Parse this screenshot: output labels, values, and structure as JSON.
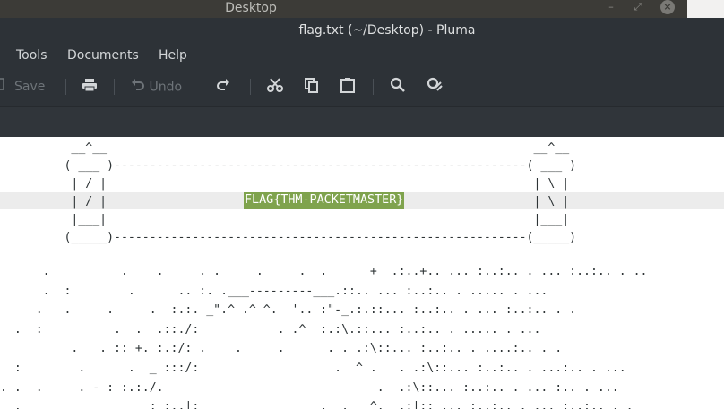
{
  "desktop": {
    "title": "Desktop",
    "controls": [
      "–",
      "⤢"
    ],
    "close": "×"
  },
  "window": {
    "title": "flag.txt (~/Desktop) - Pluma"
  },
  "menu": {
    "tools": "Tools",
    "documents": "Documents",
    "help": "Help"
  },
  "toolbar": {
    "save_label": "Save",
    "undo_label": "Undo",
    "icons": [
      "save-icon",
      "print-icon",
      "undo-icon",
      "redo-icon",
      "cut-icon",
      "copy-icon",
      "paste-icon",
      "search-icon",
      "replace-icon"
    ]
  },
  "editor": {
    "art_lines": [
      "          __^__                                                            __^__",
      "         ( ___ )----------------------------------------------------------( ___ )",
      "          | / |                                                            | \\ |",
      "          | / |                                                            | \\ |",
      "          |___|                                                            |___|",
      "         (_____)----------------------------------------------------------(_____)"
    ],
    "flag_text": "FLAG{THM-PACKETMASTER}",
    "ascii_lines": [
      "      .          .    .     . .     .     .  .      +  .:..+.. ... :..:.. . ... :..:.. . ..",
      "      .  :        .      .. :. .___---------___.::.. ... :..:.. . ..... . ...",
      "     .   .     .     .  :.:. _\".^ .^ ^.  '.. :\"-_.:.::... :..:.. . ... :..:.. . .",
      "  .  :          .  .  .::./:           . .^  :.:\\.::... :..:.. . ..... . ...",
      "          .   . :: +. :.:/: .    .     .      . . .:\\::... :..:.. . ....:.. . .",
      "  :        .      .  _ :::/:                   .  ^ .   . .:\\::... :..:.. . ...:.. . ...",
      ". .  .     . - : :.:./.                              .  .:\\::... :..:.. . ... :.. . ...",
      "  .                  : :..|:                 .  .   ^.  .:|:: ... :..:.. . ... :..:.. . ."
    ]
  }
}
